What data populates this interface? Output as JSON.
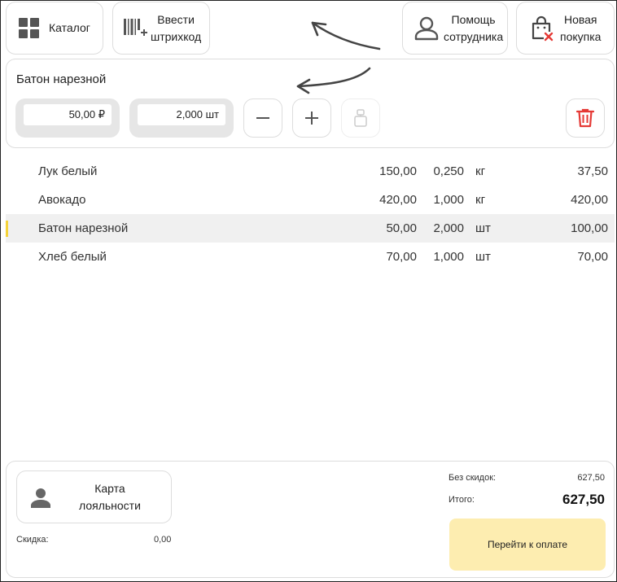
{
  "toolbar": {
    "catalog_label": "Каталог",
    "barcode_label_line1": "Ввести",
    "barcode_label_line2": "штрихкод",
    "help_label_line1": "Помощь",
    "help_label_line2": "сотрудника",
    "new_purchase_line1": "Новая",
    "new_purchase_line2": "покупка"
  },
  "selected_product": {
    "name": "Батон нарезной",
    "price": "50,00 ₽",
    "quantity": "2,000 шт"
  },
  "items": [
    {
      "name": "Лук белый",
      "price": "150,00",
      "qty": "0,250",
      "unit": "кг",
      "sum": "37,50"
    },
    {
      "name": "Авокадо",
      "price": "420,00",
      "qty": "1,000",
      "unit": "кг",
      "sum": "420,00"
    },
    {
      "name": "Батон нарезной",
      "price": "50,00",
      "qty": "2,000",
      "unit": "шт",
      "sum": "100,00"
    },
    {
      "name": "Хлеб белый",
      "price": "70,00",
      "qty": "1,000",
      "unit": "шт",
      "sum": "70,00"
    }
  ],
  "summary": {
    "loyalty_line1": "Карта",
    "loyalty_line2": "лояльности",
    "discount_label": "Скидка:",
    "discount_value": "0,00",
    "no_discount_label": "Без скидок:",
    "no_discount_value": "627,50",
    "total_label": "Итого:",
    "total_value": "627,50",
    "pay_label": "Перейти к оплате"
  },
  "colors": {
    "accent": "#f5d33a",
    "pay_button": "#fdedb0",
    "delete": "#e53935"
  }
}
